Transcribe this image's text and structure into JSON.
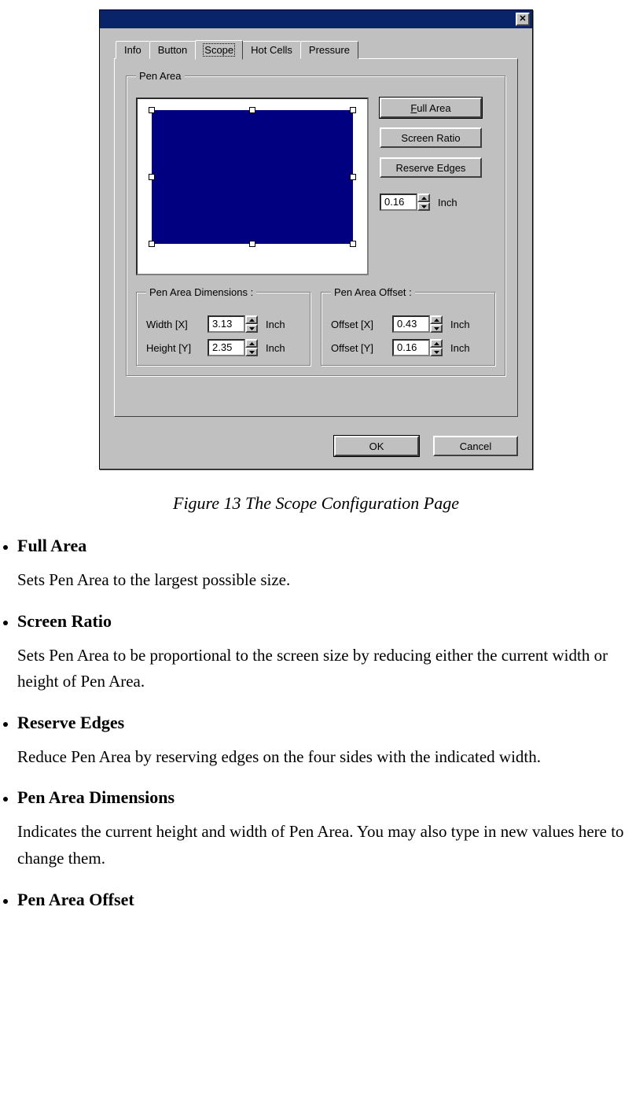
{
  "dialog": {
    "tabs": {
      "info": "Info",
      "button": "Button",
      "scope": "Scope",
      "hotcells": "Hot Cells",
      "pressure": "Pressure"
    },
    "pen_area": {
      "legend": "Pen Area",
      "full_area": "Full Area",
      "screen_ratio": "Screen Ratio",
      "reserve_edges": "Reserve Edges",
      "reserve_value": "0.16",
      "inch": "Inch"
    },
    "dimensions": {
      "legend": "Pen Area Dimensions :",
      "width_label": "Width [X]",
      "width_value": "3.13",
      "height_label": "Height [Y]",
      "height_value": "2.35",
      "inch": "Inch"
    },
    "offset": {
      "legend": "Pen Area Offset :",
      "x_label": "Offset [X]",
      "x_value": "0.43",
      "y_label": "Offset [Y]",
      "y_value": "0.16",
      "inch": "Inch"
    },
    "ok": "OK",
    "cancel": "Cancel"
  },
  "doc": {
    "caption": "Figure 13 The Scope Configuration Page",
    "items": [
      {
        "term": "Full Area",
        "desc": "Sets Pen Area to the largest possible size."
      },
      {
        "term": "Screen Ratio",
        "desc": "Sets Pen Area to be proportional to the screen size by reducing either the current width or height of Pen Area."
      },
      {
        "term": "Reserve Edges",
        "desc": "Reduce Pen Area by reserving edges on the four sides with the indicated width."
      },
      {
        "term": "Pen Area Dimensions",
        "desc": "Indicates the current height and width of Pen Area. You may also type in new values here to change them."
      },
      {
        "term": "Pen Area Offset",
        "desc": ""
      }
    ]
  }
}
